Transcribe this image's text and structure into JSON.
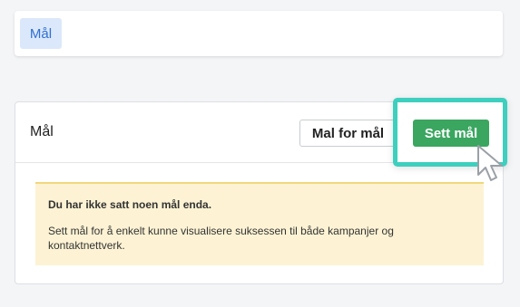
{
  "top_tabs": {
    "goals_tab": "Mål"
  },
  "panel": {
    "title": "Mål",
    "template_button": "Mal for mål",
    "set_goal_button": "Sett mål"
  },
  "alert": {
    "title": "Du har ikke satt noen mål enda.",
    "body": "Sett mål for å enkelt kunne visualisere suksessen til både kampanjer og kontaktnettverk."
  },
  "colors": {
    "accent_highlight": "#3ecfbf",
    "primary_button": "#3aa660",
    "tab_active_bg": "#dbe8fb",
    "tab_active_text": "#2f6fd1",
    "alert_bg": "#fdf3d4"
  },
  "icons": {
    "cursor": "mouse-pointer-icon"
  }
}
